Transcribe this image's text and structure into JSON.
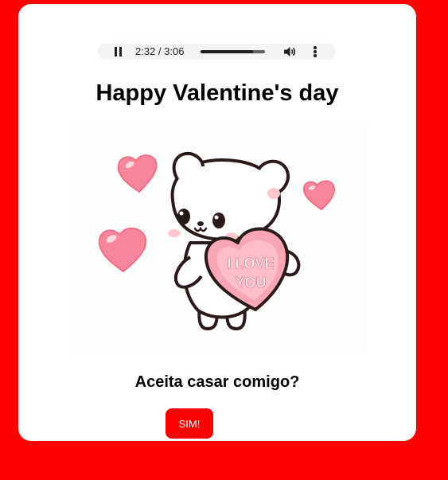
{
  "audio_player": {
    "current_time": "2:32",
    "duration": "3:06",
    "time_display": "2:32 / 3:06",
    "progress_fraction": 0.82,
    "state": "playing"
  },
  "page": {
    "title": "Happy Valentine's day",
    "question": "Aceita casar comigo?",
    "yes_label": "SIM!"
  },
  "illustration": {
    "heart_text_line1": "I LOVE",
    "heart_text_line2": "YOU"
  },
  "colors": {
    "background": "#ff0000",
    "card": "#ffffff",
    "button": "#ff0000",
    "heart_pink": "#f47a92",
    "heart_light": "#ffb3c1"
  }
}
